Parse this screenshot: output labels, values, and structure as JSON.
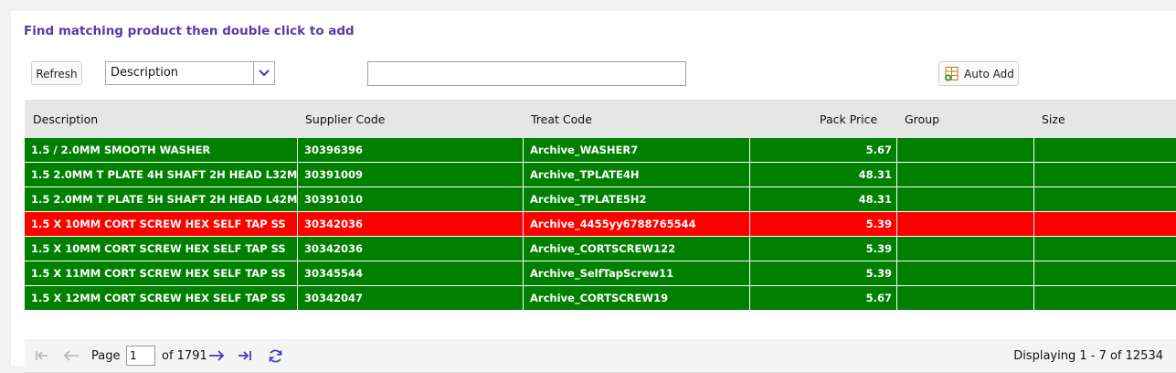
{
  "heading": "Find matching product then double click to add",
  "toolbar": {
    "refresh_label": "Refresh",
    "field_select_value": "Description",
    "search_value": "",
    "auto_add_label": "Auto Add"
  },
  "grid": {
    "columns": [
      "Description",
      "Supplier Code",
      "Treat Code",
      "Pack Price",
      "Group",
      "Size"
    ],
    "rows": [
      {
        "description": "1.5 / 2.0MM SMOOTH WASHER",
        "supplier_code": "30396396",
        "treat_code": "Archive_WASHER7",
        "pack_price": "5.67",
        "group": "",
        "size": "",
        "status": "green"
      },
      {
        "description": "1.5 2.0MM T PLATE 4H SHAFT 2H HEAD L32MM",
        "supplier_code": "30391009",
        "treat_code": "Archive_TPLATE4H",
        "pack_price": "48.31",
        "group": "",
        "size": "",
        "status": "green"
      },
      {
        "description": "1.5 2.0MM T PLATE 5H SHAFT 2H HEAD L42MM",
        "supplier_code": "30391010",
        "treat_code": "Archive_TPLATE5H2",
        "pack_price": "48.31",
        "group": "",
        "size": "",
        "status": "green"
      },
      {
        "description": "1.5 X 10MM CORT SCREW HEX SELF TAP SS",
        "supplier_code": "30342036",
        "treat_code": "Archive_4455yy6788765544",
        "pack_price": "5.39",
        "group": "",
        "size": "",
        "status": "red"
      },
      {
        "description": "1.5 X 10MM CORT SCREW HEX SELF TAP SS",
        "supplier_code": "30342036",
        "treat_code": "Archive_CORTSCREW122",
        "pack_price": "5.39",
        "group": "",
        "size": "",
        "status": "green"
      },
      {
        "description": "1.5 X 11MM CORT SCREW HEX SELF TAP SS",
        "supplier_code": "30345544",
        "treat_code": "Archive_SelfTapScrew11",
        "pack_price": "5.39",
        "group": "",
        "size": "",
        "status": "green"
      },
      {
        "description": "1.5 X 12MM CORT SCREW HEX SELF TAP SS",
        "supplier_code": "30342047",
        "treat_code": "Archive_CORTSCREW19",
        "pack_price": "5.67",
        "group": "",
        "size": "",
        "status": "green"
      }
    ]
  },
  "pager": {
    "page_label": "Page",
    "page_value": "1",
    "of_label": "of 1791",
    "display_text": "Displaying 1 - 7 of 12534"
  },
  "colors": {
    "row_green": "#008000",
    "row_red": "#ff0000",
    "heading": "#5a3aa6",
    "accent_blue": "#3a3ac8"
  },
  "icons": [
    "chevron-down-icon",
    "grid-add-icon",
    "first-page-icon",
    "prev-page-icon",
    "next-page-icon",
    "last-page-icon",
    "refresh-icon"
  ]
}
